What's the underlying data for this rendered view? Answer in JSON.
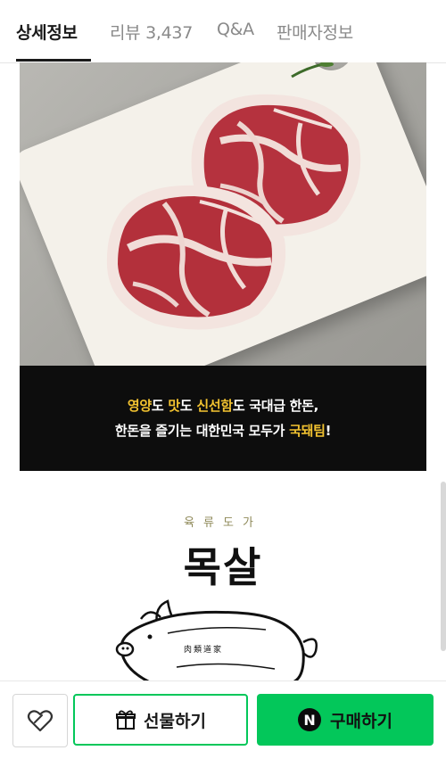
{
  "tabs": [
    {
      "label": "상세정보",
      "active": true
    },
    {
      "label": "리뷰 3,437",
      "active": false
    },
    {
      "label": "Q&A",
      "active": false
    },
    {
      "label": "판매자정보",
      "active": false
    }
  ],
  "banner": {
    "line1": {
      "p1": "영양",
      "p2": "도 ",
      "p3": "맛",
      "p4": "도 ",
      "p5": "신선함",
      "p6": "도 국대급 한돈,"
    },
    "line2": {
      "p1": "한돈을 즐기는 대한민국 모두가 ",
      "p2": "국돼팀",
      "p3": "!"
    },
    "highlight_color": "#f2c230"
  },
  "brand": {
    "subtitle": "육류도가",
    "title": "목살",
    "pig_label": "肉類道家"
  },
  "bottom_bar": {
    "wishlist_icon": "heart-outline-icon",
    "gift_label": "선물하기",
    "gift_icon": "gift-icon",
    "buy_label": "구매하기",
    "buy_icon": "npay-icon",
    "npay_letter": "N",
    "accent_color": "#03c75a"
  }
}
